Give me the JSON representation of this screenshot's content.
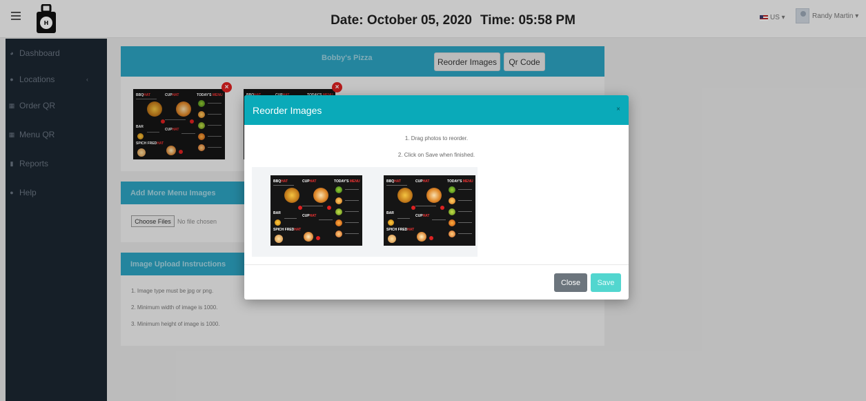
{
  "header": {
    "date_text": "Date: October 05, 2020",
    "time_text": "Time: 05:58 PM",
    "lang_label": "US ▾",
    "user_label": "Randy Martin ▾"
  },
  "sidebar": {
    "items": [
      {
        "label": "Dashboard",
        "icon": "dashboard-icon"
      },
      {
        "label": "Locations",
        "icon": "map-marker-icon"
      },
      {
        "label": "Order QR",
        "icon": "qr-icon"
      },
      {
        "label": "Menu QR",
        "icon": "qr-icon"
      },
      {
        "label": "Reports",
        "icon": "report-icon"
      },
      {
        "label": "Help",
        "icon": "help-icon"
      }
    ]
  },
  "main": {
    "store_name": "Bobby's Pizza",
    "reorder_button": "Reorder Images",
    "qr_button": "Qr Code",
    "add_images_title": "Add More Menu Images",
    "choose_files_label": "Choose Files",
    "no_file_text": "No file chosen",
    "instructions_title": "Image Upload Instructions",
    "instructions": [
      "1. Image type must be jpg or png.",
      "2. Minimum width of image is 1000.",
      "3. Minimum height of image is 1000."
    ]
  },
  "modal": {
    "title": "Reorder Images",
    "close_x": "×",
    "steps": [
      "1. Drag photos to reorder.",
      "2. Click on Save when finished."
    ],
    "close_label": "Close",
    "save_label": "Save"
  },
  "menu_thumb": {
    "col1": "BBQ",
    "col1_accent": "HAT",
    "col2": "CUP",
    "col2_accent": "HAT",
    "col3": "TODAY'S",
    "col3_accent": "MENU",
    "row2": "BAR",
    "row3": "CUP",
    "row3_accent": "HAT",
    "row4": "SPICH FRED",
    "row4_accent": "HAT"
  }
}
